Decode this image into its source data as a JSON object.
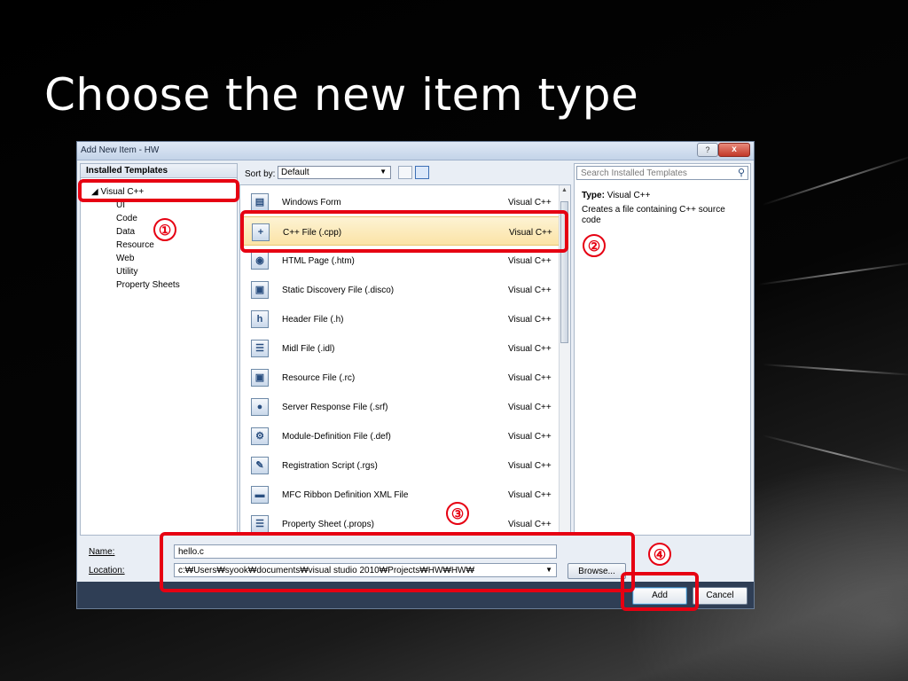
{
  "slide": {
    "title": "Choose the new item type"
  },
  "dialog": {
    "title": "Add New Item - HW",
    "help_label": "?",
    "close_label": "x",
    "left_pane": {
      "header": "Installed Templates",
      "root": "Visual C++",
      "children": [
        "UI",
        "Code",
        "Data",
        "Resource",
        "Web",
        "Utility",
        "Property Sheets"
      ]
    },
    "sort": {
      "label": "Sort by:",
      "value": "Default"
    },
    "items": [
      {
        "name": "Windows Form",
        "lang": "Visual C++",
        "icon": "windows-form-icon"
      },
      {
        "name": "C++ File (.cpp)",
        "lang": "Visual C++",
        "icon": "cpp-file-icon"
      },
      {
        "name": "HTML Page (.htm)",
        "lang": "Visual C++",
        "icon": "html-page-icon"
      },
      {
        "name": "Static Discovery File (.disco)",
        "lang": "Visual C++",
        "icon": "disco-file-icon"
      },
      {
        "name": "Header File (.h)",
        "lang": "Visual C++",
        "icon": "header-file-icon"
      },
      {
        "name": "Midl File (.idl)",
        "lang": "Visual C++",
        "icon": "midl-file-icon"
      },
      {
        "name": "Resource File (.rc)",
        "lang": "Visual C++",
        "icon": "resource-file-icon"
      },
      {
        "name": "Server Response File (.srf)",
        "lang": "Visual C++",
        "icon": "srf-file-icon"
      },
      {
        "name": "Module-Definition File (.def)",
        "lang": "Visual C++",
        "icon": "def-file-icon"
      },
      {
        "name": "Registration Script (.rgs)",
        "lang": "Visual C++",
        "icon": "rgs-file-icon"
      },
      {
        "name": "MFC Ribbon Definition XML File",
        "lang": "Visual C++",
        "icon": "ribbon-xml-icon"
      },
      {
        "name": "Property Sheet (.props)",
        "lang": "Visual C++",
        "icon": "property-sheet-icon"
      }
    ],
    "search": {
      "placeholder": "Search Installed Templates"
    },
    "details": {
      "type_label": "Type:",
      "type_value": "Visual C++",
      "description": "Creates a file containing C++ source code"
    },
    "name_field": {
      "label": "Name:",
      "value": "hello.c"
    },
    "location_field": {
      "label": "Location:",
      "value": "c:₩Users₩syook₩documents₩visual studio 2010₩Projects₩HW₩HW₩"
    },
    "browse_label": "Browse...",
    "add_label": "Add",
    "cancel_label": "Cancel"
  },
  "markers": [
    "①",
    "②",
    "③",
    "④"
  ],
  "colors": {
    "highlight": "#e60012",
    "selection": "#fbe3a6",
    "footer": "#2f3e55"
  }
}
